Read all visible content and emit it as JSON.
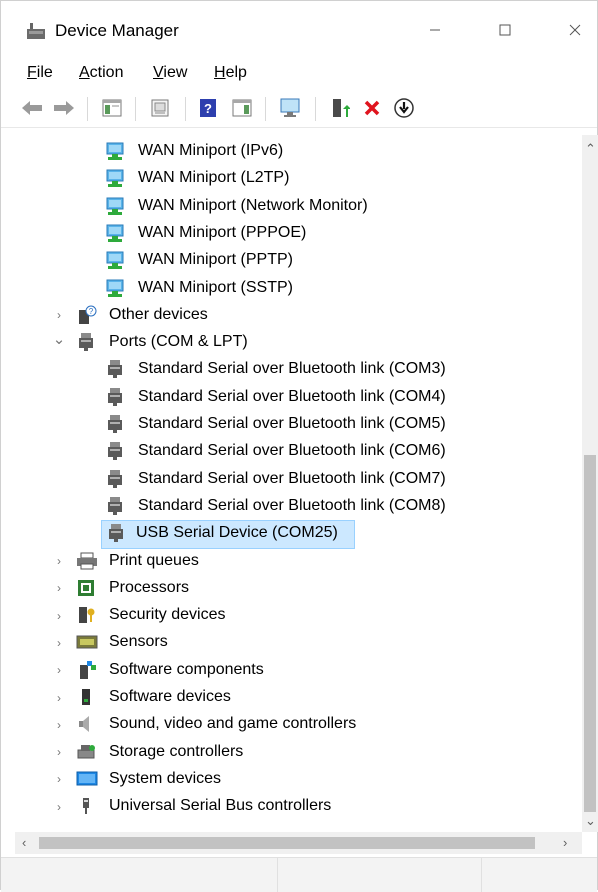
{
  "window": {
    "title": "Device Manager"
  },
  "menu": [
    {
      "label_u": "F",
      "label_rest": "ile"
    },
    {
      "label_u": "A",
      "label_rest": "ction"
    },
    {
      "label_u": "V",
      "label_rest": "iew"
    },
    {
      "label_u": "H",
      "label_rest": "elp"
    }
  ],
  "tree": {
    "wan": [
      "WAN Miniport (IPv6)",
      "WAN Miniport (L2TP)",
      "WAN Miniport (Network Monitor)",
      "WAN Miniport (PPPOE)",
      "WAN Miniport (PPTP)",
      "WAN Miniport (SSTP)"
    ],
    "other_devices": "Other devices",
    "ports": "Ports (COM & LPT)",
    "port_items": [
      "Standard Serial over Bluetooth link (COM3)",
      "Standard Serial over Bluetooth link (COM4)",
      "Standard Serial over Bluetooth link (COM5)",
      "Standard Serial over Bluetooth link (COM6)",
      "Standard Serial over Bluetooth link (COM7)",
      "Standard Serial over Bluetooth link (COM8)"
    ],
    "selected": "USB Serial Device (COM25)",
    "categories": [
      "Print queues",
      "Processors",
      "Security devices",
      "Sensors",
      "Software components",
      "Software devices",
      "Sound, video and game controllers",
      "Storage controllers",
      "System devices",
      "Universal Serial Bus controllers"
    ]
  },
  "icons": {
    "wan": "network-adapter-icon",
    "port": "port-connector-icon",
    "accent_selected": "#cce8ff",
    "accent_selected_border": "#99d1ff"
  }
}
